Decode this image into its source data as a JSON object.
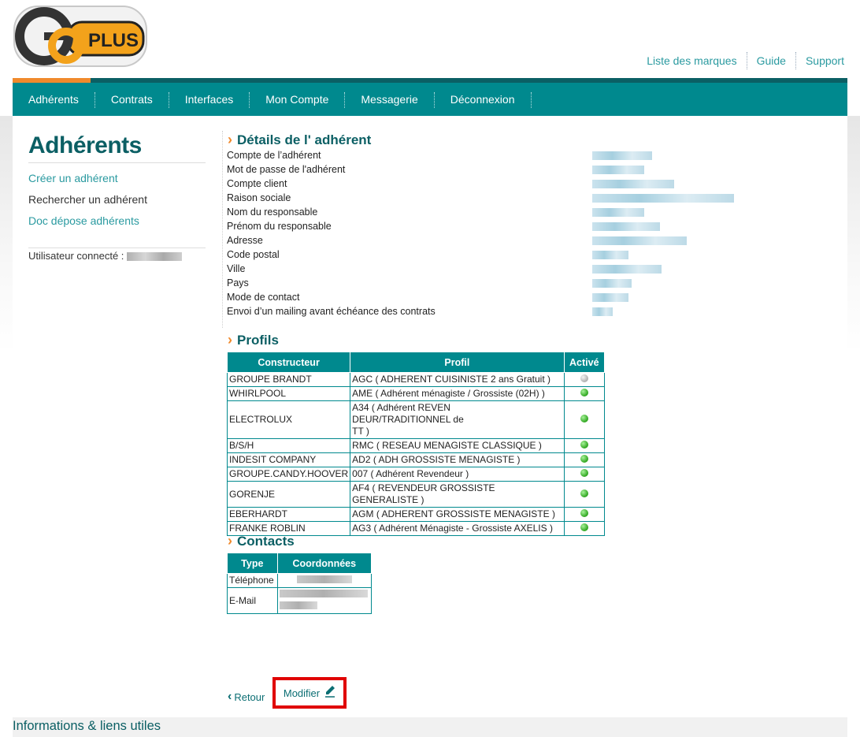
{
  "brand": {
    "logo_text": "PLUS"
  },
  "top_links": [
    "Liste des marques",
    "Guide",
    "Support"
  ],
  "nav": [
    "Adhérents",
    "Contrats",
    "Interfaces",
    "Mon Compte",
    "Messagerie",
    "Déconnexion"
  ],
  "sidebar": {
    "title": "Adhérents",
    "links": [
      "Créer un adhérent",
      "Rechercher un adhérent",
      "Doc dépose adhérents"
    ],
    "user_label": "Utilisateur connecté :"
  },
  "details": {
    "heading": "Détails de l' adhérent",
    "fields": [
      "Compte de l’adhérent",
      "Mot de passe de l'adhérent",
      "Compte client",
      "Raison sociale",
      "Nom du responsable",
      "Prénom du responsable",
      "Adresse",
      "Code postal",
      "Ville",
      "Pays",
      "Mode de contact",
      "Envoi d’un mailing avant échéance des contrats"
    ]
  },
  "profils": {
    "heading": "Profils",
    "headers": [
      "Constructeur",
      "Profil",
      "Activé"
    ],
    "rows": [
      {
        "constructeur": "GROUPE BRANDT",
        "profil": "AGC ( ADHERENT CUISINISTE 2 ans Gratuit )",
        "active": false
      },
      {
        "constructeur": "WHIRLPOOL",
        "profil": "AME ( Adhérent ménagiste / Grossiste (02H) )",
        "active": true
      },
      {
        "constructeur": "ELECTROLUX",
        "profil": "A34 ( Adhérent REVEN\nDEUR/TRADITIONNEL de\nTT )",
        "active": true
      },
      {
        "constructeur": "B/S/H",
        "profil": "RMC ( RESEAU MENAGISTE CLASSIQUE )",
        "active": true
      },
      {
        "constructeur": "INDESIT COMPANY",
        "profil": "AD2 ( ADH GROSSISTE MENAGISTE )",
        "active": true
      },
      {
        "constructeur": "GROUPE.CANDY.HOOVER",
        "profil": "007 ( Adhérent Revendeur )",
        "active": true
      },
      {
        "constructeur": "GORENJE",
        "profil": "AF4 ( REVENDEUR GROSSISTE GENERALISTE )",
        "active": true
      },
      {
        "constructeur": "EBERHARDT",
        "profil": "AGM ( ADHERENT GROSSISTE MENAGISTE )",
        "active": true
      },
      {
        "constructeur": "FRANKE ROBLIN",
        "profil": "AG3 ( Adhérent Ménagiste - Grossiste AXELIS )",
        "active": true
      }
    ]
  },
  "contacts": {
    "heading": "Contacts",
    "headers": [
      "Type",
      "Coordonnées"
    ],
    "rows": [
      {
        "type": "Téléphone"
      },
      {
        "type": "E-Mail"
      }
    ]
  },
  "actions": {
    "retour": "Retour",
    "modifier": "Modifier"
  },
  "footer": {
    "title": "Informations & liens utiles"
  },
  "colors": {
    "teal": "#00898e",
    "dark_teal": "#0b5f64",
    "orange": "#f08a2c",
    "highlight": "#e00000"
  }
}
